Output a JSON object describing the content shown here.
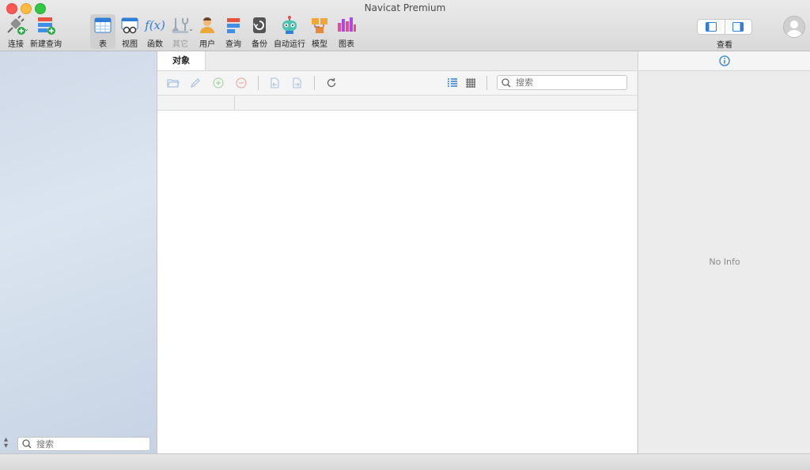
{
  "window": {
    "title": "Navicat Premium"
  },
  "toolbar": {
    "items": [
      {
        "label": "连接",
        "icon": "connection-icon"
      },
      {
        "label": "新建查询",
        "icon": "new-query-icon"
      },
      {
        "label": "表",
        "icon": "table-icon"
      },
      {
        "label": "视图",
        "icon": "view-icon"
      },
      {
        "label": "函数",
        "icon": "function-icon"
      },
      {
        "label": "其它",
        "icon": "other-icon"
      },
      {
        "label": "用户",
        "icon": "user-icon"
      },
      {
        "label": "查询",
        "icon": "query-icon"
      },
      {
        "label": "备份",
        "icon": "backup-icon"
      },
      {
        "label": "自动运行",
        "icon": "automation-icon"
      },
      {
        "label": "模型",
        "icon": "model-icon"
      },
      {
        "label": "图表",
        "icon": "chart-icon"
      }
    ],
    "fx": "f(x)",
    "view_label": "查看"
  },
  "sidebar": {
    "search_placeholder": "搜索"
  },
  "main": {
    "tab_label": "对象",
    "search_placeholder": "搜索"
  },
  "info_panel": {
    "empty_text": "No Info"
  }
}
